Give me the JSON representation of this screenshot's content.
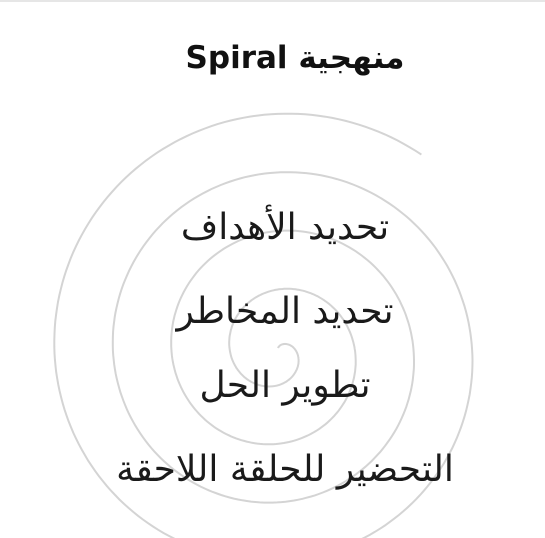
{
  "title": "منهجية Spiral",
  "steps": [
    "تحديد الأهداف",
    "تحديد المخاطر",
    "تطوير الحل",
    "التحضير للحلقة اللاحقة"
  ],
  "colors": {
    "background": "#ffffff",
    "text": "#1a1a1a",
    "spiral": "#d4d4d4"
  }
}
